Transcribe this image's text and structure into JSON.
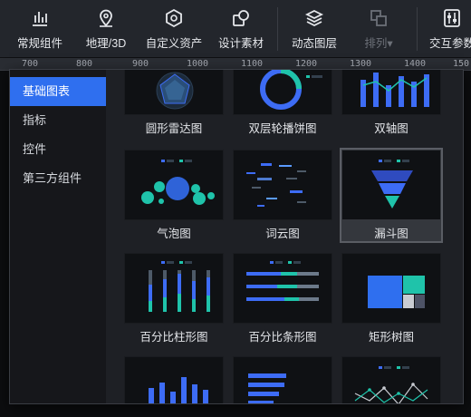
{
  "toolbar": {
    "items": [
      {
        "label": "常规组件",
        "icon": "bar-chart-icon"
      },
      {
        "label": "地理/3D",
        "icon": "map-pin-icon"
      },
      {
        "label": "自定义资产",
        "icon": "hexagon-icon"
      },
      {
        "label": "设计素材",
        "icon": "design-material-icon"
      },
      {
        "label": "动态图层",
        "icon": "layers-icon"
      },
      {
        "label": "排列▾",
        "icon": "arrange-icon"
      },
      {
        "label": "交互参数",
        "icon": "sliders-icon"
      }
    ]
  },
  "ruler": {
    "ticks": [
      "700",
      "800",
      "900",
      "1000",
      "1100",
      "1200",
      "1300",
      "1400",
      "150"
    ]
  },
  "sidebar": {
    "items": [
      {
        "label": "基础图表",
        "active": true
      },
      {
        "label": "指标"
      },
      {
        "label": "控件"
      },
      {
        "label": "第三方组件"
      }
    ]
  },
  "cards": [
    {
      "caption": "圆形雷达图",
      "icon": "radar-chart-icon"
    },
    {
      "caption": "双层轮播饼图",
      "icon": "donut-chart-icon"
    },
    {
      "caption": "双轴图",
      "icon": "dual-axis-chart-icon"
    },
    {
      "caption": "气泡图",
      "icon": "bubble-chart-icon"
    },
    {
      "caption": "词云图",
      "icon": "word-cloud-icon"
    },
    {
      "caption": "漏斗图",
      "icon": "funnel-chart-icon",
      "selected": true
    },
    {
      "caption": "百分比柱形图",
      "icon": "percent-column-chart-icon"
    },
    {
      "caption": "百分比条形图",
      "icon": "percent-bar-chart-icon"
    },
    {
      "caption": "矩形树图",
      "icon": "treemap-chart-icon"
    },
    {
      "caption": "",
      "icon": "column-chart-icon"
    },
    {
      "caption": "",
      "icon": "bar-chart-icon"
    },
    {
      "caption": "",
      "icon": "line-chart-icon"
    }
  ],
  "colors": {
    "accent": "#2f6fef",
    "teal": "#1fc3aa",
    "blue": "#3d6cf5",
    "light_blue": "#5a9bff"
  }
}
